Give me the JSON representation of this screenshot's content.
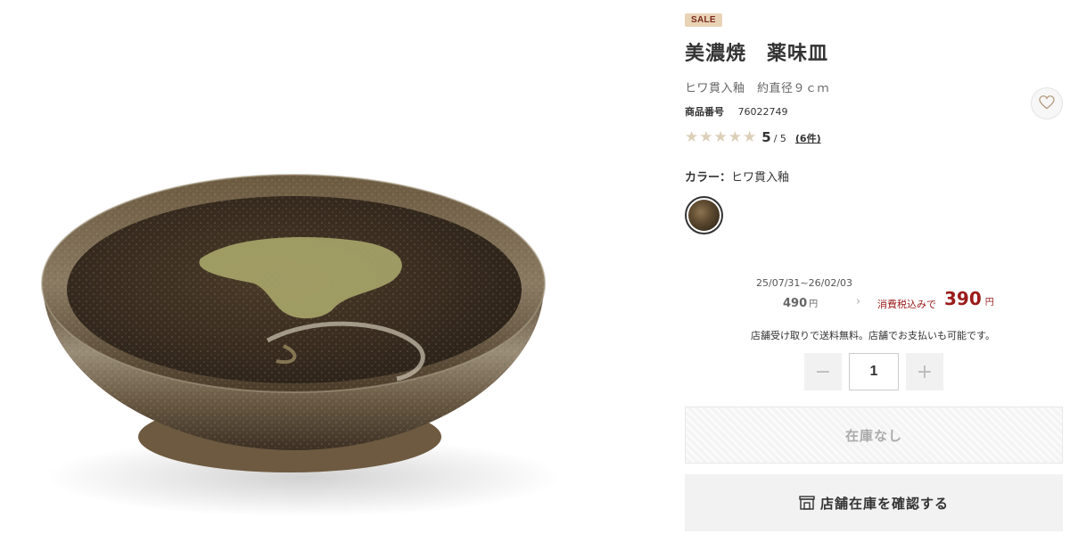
{
  "product": {
    "sale_badge": "SALE",
    "title": "美濃焼　薬味皿",
    "subtitle": "ヒワ貫入釉　約直径９ｃｍ",
    "number_label": "商品番号",
    "number_value": "76022749",
    "image_icon": "product-photo-small-ceramic-dish"
  },
  "rating": {
    "stars_filled": 5,
    "score": "5",
    "score_max": "/ 5",
    "review_count": "(6件)"
  },
  "color": {
    "label": "カラー：",
    "value": "ヒワ貫入釉"
  },
  "price": {
    "period": "25/07/31~26/02/03",
    "old_price": "490",
    "old_price_unit": "円",
    "arrow": "›",
    "tax_label": "消費税込みで",
    "new_price": "390",
    "new_price_unit": "円",
    "sale_color": "#9b1b1b"
  },
  "shipping_note": "店舗受け取りで送料無料。店舗でお支払いも可能です。",
  "quantity": {
    "minus": "−",
    "value": "1",
    "plus": "+"
  },
  "buttons": {
    "out_of_stock": "在庫なし",
    "store_stock": "店舗在庫を確認する",
    "store_icon": "store-icon",
    "favorite_icon": "heart-icon"
  }
}
